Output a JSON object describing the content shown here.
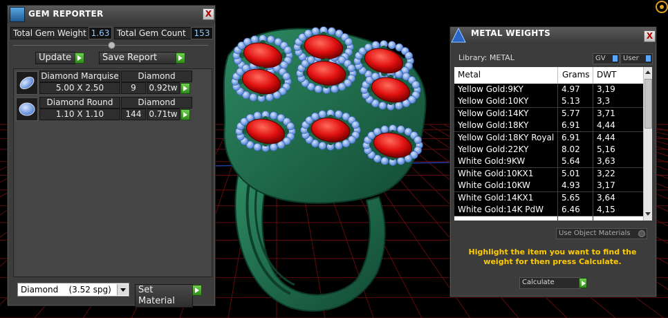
{
  "gem_reporter": {
    "title": "GEM REPORTER",
    "close": "X",
    "total_weight_label": "Total Gem Weight",
    "total_weight_value": "1.63",
    "total_count_label": "Total Gem Count",
    "total_count_value": "153",
    "update_label": "Update",
    "save_report_label": "Save Report",
    "gems": [
      {
        "name": "Diamond Marquise",
        "material": "Diamond",
        "size": "5.00 X 2.50",
        "count": "9",
        "weight": "0.92tw"
      },
      {
        "name": "Diamond Round",
        "material": "Diamond",
        "size": "1.10 X 1.10",
        "count": "144",
        "weight": "0.71tw"
      }
    ],
    "material_select": "Diamond    (3.52 spg)",
    "set_material_label": "Set Material"
  },
  "metal_weights": {
    "title": "METAL WEIGHTS",
    "close": "X",
    "library_label": "Library: METAL",
    "gv_label": "GV",
    "user_label": "User",
    "columns": [
      "Metal",
      "Grams",
      "DWT"
    ],
    "rows": [
      [
        "Yellow Gold:9KY",
        "4.97",
        "3,19"
      ],
      [
        "Yellow Gold:10KY",
        "5.13",
        "3,3"
      ],
      [
        "Yellow Gold:14KY",
        "5.77",
        "3,71"
      ],
      [
        "Yellow Gold:18KY",
        "6.91",
        "4,44"
      ],
      [
        "Yellow Gold:18KY Royal",
        "6.91",
        "4,44"
      ],
      [
        "Yellow Gold:22KY",
        "8.02",
        "5,16"
      ],
      [
        "White Gold:9KW",
        "5.64",
        "3,63"
      ],
      [
        "White Gold:10KX1",
        "5.01",
        "3,22"
      ],
      [
        "White Gold:10KW",
        "4.93",
        "3,17"
      ],
      [
        "White Gold:14KX1",
        "5.65",
        "3,64"
      ],
      [
        "White Gold:14K PdW",
        "6.46",
        "4,15"
      ]
    ],
    "use_object_materials": "Use Object Materials",
    "instruction": "Highlight the item you want to find the weight for then press Calculate.",
    "calculate_label": "Calculate"
  },
  "colors": {
    "ring": "#1f6b4e",
    "ruby": "#e01010",
    "diamond": "#8fb8ff",
    "grid": "#7a1010",
    "accent_text": "#ffcc00"
  }
}
